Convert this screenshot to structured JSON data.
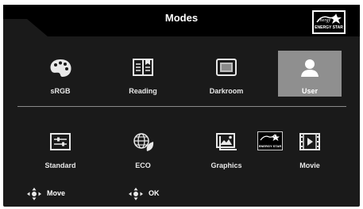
{
  "header": {
    "title": "Modes",
    "energy_star_label": "ENERGY STAR"
  },
  "modes_row1": [
    {
      "label": "sRGB",
      "icon": "palette-icon",
      "selected": false
    },
    {
      "label": "Reading",
      "icon": "book-icon",
      "selected": false
    },
    {
      "label": "Darkroom",
      "icon": "darkroom-icon",
      "selected": false
    },
    {
      "label": "User",
      "icon": "user-icon",
      "selected": true
    }
  ],
  "modes_row2": [
    {
      "label": "Standard",
      "icon": "sliders-icon",
      "selected": false
    },
    {
      "label": "ECO",
      "icon": "globe-leaf-icon",
      "selected": false
    },
    {
      "label": "Graphics",
      "icon": "image-icon",
      "selected": false
    },
    {
      "label": "Movie",
      "icon": "film-icon",
      "selected": false
    }
  ],
  "standard_energy_star_label": "ENERGY STAR",
  "footer": {
    "move_label": "Move",
    "ok_label": "OK"
  },
  "colors": {
    "panel": "#1a1a1a",
    "selected": "#8f8f8f",
    "text": "#e8e8e8"
  }
}
